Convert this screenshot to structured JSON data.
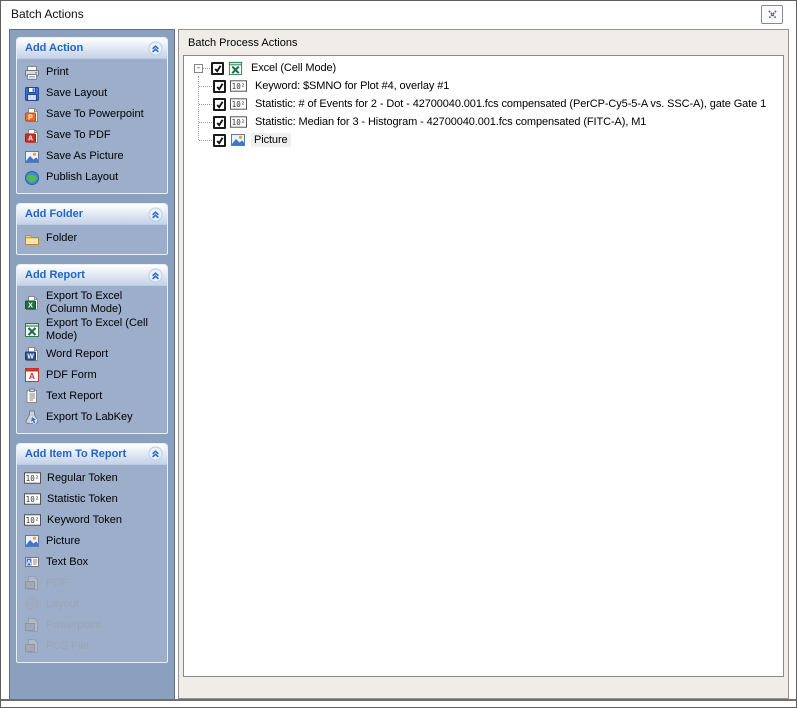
{
  "window": {
    "title": "Batch Actions"
  },
  "colors": {
    "sidebar_bg": "#8BA0BE",
    "panel_bg": "#9CAECA",
    "panel_header_text": "#1E66C5",
    "main_bg": "#F0EDE8",
    "disabled_text": "#9AA6B6",
    "selection_bg": "#EFEFEF"
  },
  "icons": {
    "token_text": "10²",
    "powerpoint_letter": "P",
    "pdf_letter": "A",
    "word_letter": "W",
    "excel_letter": "X",
    "textbox_letter": "A",
    "expander_glyph": "-"
  },
  "sidebar": {
    "panels": [
      {
        "title": "Add Action",
        "items": [
          {
            "label": "Print",
            "icon": "printer-icon"
          },
          {
            "label": "Save Layout",
            "icon": "floppy-icon"
          },
          {
            "label": "Save To Powerpoint",
            "icon": "powerpoint-page-icon"
          },
          {
            "label": "Save To PDF",
            "icon": "pdf-page-icon"
          },
          {
            "label": "Save As Picture",
            "icon": "picture-icon"
          },
          {
            "label": "Publish Layout",
            "icon": "globe-icon"
          }
        ]
      },
      {
        "title": "Add Folder",
        "items": [
          {
            "label": "Folder",
            "icon": "folder-icon"
          }
        ]
      },
      {
        "title": "Add Report",
        "items": [
          {
            "label": "Export To Excel (Column Mode)",
            "icon": "excel-page-icon"
          },
          {
            "label": "Export To Excel (Cell Mode)",
            "icon": "excel-grid-icon"
          },
          {
            "label": "Word Report",
            "icon": "word-page-icon"
          },
          {
            "label": "PDF Form",
            "icon": "pdf-form-icon"
          },
          {
            "label": "Text Report",
            "icon": "text-report-icon"
          },
          {
            "label": "Export To LabKey",
            "icon": "labkey-icon"
          }
        ]
      },
      {
        "title": "Add Item To Report",
        "items": [
          {
            "label": "Regular Token",
            "icon": "token-icon",
            "disabled": false
          },
          {
            "label": "Statistic Token",
            "icon": "token-icon",
            "disabled": false
          },
          {
            "label": "Keyword Token",
            "icon": "token-icon",
            "disabled": false
          },
          {
            "label": "Picture",
            "icon": "picture-icon",
            "disabled": false
          },
          {
            "label": "Text Box",
            "icon": "textbox-icon",
            "disabled": false
          },
          {
            "label": "PDF",
            "icon": "gray-page-icon",
            "disabled": true
          },
          {
            "label": "Layout",
            "icon": "layout-icon",
            "disabled": true
          },
          {
            "label": "Powerpoint",
            "icon": "gray-page-icon",
            "disabled": true
          },
          {
            "label": "FCS File",
            "icon": "gray-page-icon",
            "disabled": true
          }
        ]
      }
    ]
  },
  "main": {
    "header": "Batch Process Actions",
    "tree": {
      "root": {
        "label": "Excel (Cell Mode)",
        "checked": true,
        "icon": "excel-grid-icon"
      },
      "children": [
        {
          "label": "Keyword: $SMNO for Plot #4, overlay #1",
          "checked": true,
          "icon": "token-icon",
          "selected": false
        },
        {
          "label": "Statistic: # of Events for 2 - Dot - 42700040.001.fcs compensated (PerCP-Cy5-5-A vs. SSC-A), gate Gate 1",
          "checked": true,
          "icon": "token-icon",
          "selected": false
        },
        {
          "label": "Statistic: Median for 3 - Histogram - 42700040.001.fcs compensated (FITC-A), M1",
          "checked": true,
          "icon": "token-icon",
          "selected": false
        },
        {
          "label": "Picture",
          "checked": true,
          "icon": "picture-icon",
          "selected": true
        }
      ]
    }
  }
}
